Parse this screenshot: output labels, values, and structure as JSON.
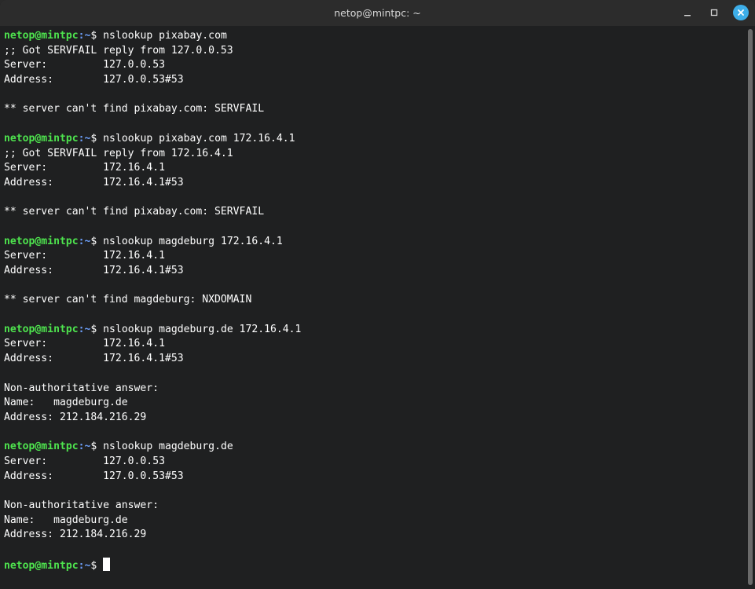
{
  "window": {
    "title": "netop@mintpc: ~",
    "controls": {
      "minimize_icon": "minimize-icon",
      "maximize_icon": "maximize-icon",
      "close_icon": "close-icon"
    },
    "accent_color": "#3daee9"
  },
  "prompt": {
    "user_host": "netop@mintpc",
    "path": ":~",
    "symbol": "$ "
  },
  "terminal": {
    "lines": [
      {
        "type": "prompt",
        "cmd": "nslookup pixabay.com"
      },
      {
        "type": "out",
        "text": ";; Got SERVFAIL reply from 127.0.0.53"
      },
      {
        "type": "out",
        "text": "Server:         127.0.0.53"
      },
      {
        "type": "out",
        "text": "Address:        127.0.0.53#53"
      },
      {
        "type": "out",
        "text": ""
      },
      {
        "type": "out",
        "text": "** server can't find pixabay.com: SERVFAIL"
      },
      {
        "type": "out",
        "text": ""
      },
      {
        "type": "prompt",
        "cmd": "nslookup pixabay.com 172.16.4.1"
      },
      {
        "type": "out",
        "text": ";; Got SERVFAIL reply from 172.16.4.1"
      },
      {
        "type": "out",
        "text": "Server:         172.16.4.1"
      },
      {
        "type": "out",
        "text": "Address:        172.16.4.1#53"
      },
      {
        "type": "out",
        "text": ""
      },
      {
        "type": "out",
        "text": "** server can't find pixabay.com: SERVFAIL"
      },
      {
        "type": "out",
        "text": ""
      },
      {
        "type": "prompt",
        "cmd": "nslookup magdeburg 172.16.4.1"
      },
      {
        "type": "out",
        "text": "Server:         172.16.4.1"
      },
      {
        "type": "out",
        "text": "Address:        172.16.4.1#53"
      },
      {
        "type": "out",
        "text": ""
      },
      {
        "type": "out",
        "text": "** server can't find magdeburg: NXDOMAIN"
      },
      {
        "type": "out",
        "text": ""
      },
      {
        "type": "prompt",
        "cmd": "nslookup magdeburg.de 172.16.4.1"
      },
      {
        "type": "out",
        "text": "Server:         172.16.4.1"
      },
      {
        "type": "out",
        "text": "Address:        172.16.4.1#53"
      },
      {
        "type": "out",
        "text": ""
      },
      {
        "type": "out",
        "text": "Non-authoritative answer:"
      },
      {
        "type": "out",
        "text": "Name:   magdeburg.de"
      },
      {
        "type": "out",
        "text": "Address: 212.184.216.29"
      },
      {
        "type": "out",
        "text": ""
      },
      {
        "type": "prompt",
        "cmd": "nslookup magdeburg.de"
      },
      {
        "type": "out",
        "text": "Server:         127.0.0.53"
      },
      {
        "type": "out",
        "text": "Address:        127.0.0.53#53"
      },
      {
        "type": "out",
        "text": ""
      },
      {
        "type": "out",
        "text": "Non-authoritative answer:"
      },
      {
        "type": "out",
        "text": "Name:   magdeburg.de"
      },
      {
        "type": "out",
        "text": "Address: 212.184.216.29"
      },
      {
        "type": "out",
        "text": ""
      },
      {
        "type": "prompt",
        "cmd": "",
        "cursor": true
      }
    ]
  },
  "colors": {
    "background": "#1f2021",
    "prompt_user": "#4ee44e",
    "prompt_path": "#6c9ef8",
    "text": "#ffffff"
  }
}
